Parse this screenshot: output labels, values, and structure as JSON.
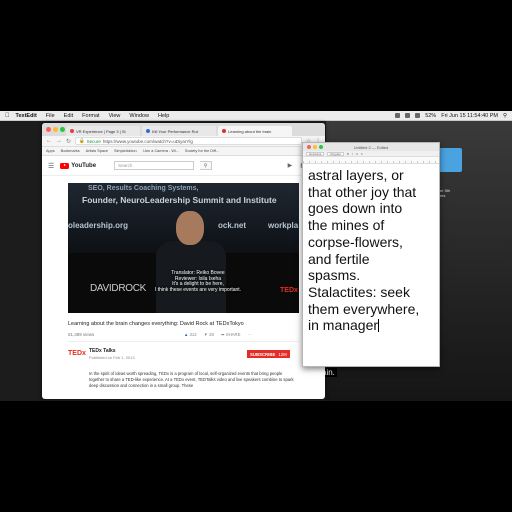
{
  "menubar": {
    "app": "TextEdit",
    "items": [
      "File",
      "Edit",
      "Format",
      "View",
      "Window",
      "Help"
    ],
    "clock": "Fri Jun 15  11:54:40 PM",
    "battery": "52%"
  },
  "desktop": {
    "label_line1": "er 5th",
    "label_line2": "ms",
    "caption": "ain."
  },
  "browser": {
    "tabs": [
      {
        "label": "VR Experience | Page 3 | St",
        "color": "#e0433a"
      },
      {
        "label": "Kill Your Performance Rut",
        "color": "#2b6de0"
      },
      {
        "label": "Learning about the brain",
        "color": "#e52d27"
      }
    ],
    "secure_label": "Secure",
    "url": "https://www.youtube.com/watch?v=uDiyarYlg",
    "bookmarks": [
      "Apps",
      "Bookmarks",
      "Artists Space",
      "SimpleAddon",
      "I Am a Camera - Wi...",
      "Society for the Diff..."
    ]
  },
  "youtube": {
    "logo": "YouTube",
    "search_placeholder": "Search",
    "video": {
      "wall_line1": "Founder, NeuroLeadership Summit and Institute",
      "wall_left": "oleadership.org",
      "wall_mid": "ock.net",
      "wall_right": "workpla",
      "speaker": "DAVIDROCK",
      "brand": "TEDx",
      "subtitles": [
        "Translator: Reiko Bovee",
        "Reviewer: Isila Iseha",
        "It's a delight to be here,",
        "I think these events are very important."
      ]
    },
    "title": "Learning about the brain changes everything: David Rock at TEDxTokyo",
    "views": "61,389 views",
    "likes": "312",
    "dislikes": "28",
    "share": "SHARE",
    "channel": {
      "logo": "TEDx",
      "name": "TEDx Talks",
      "published": "Published on Feb 1, 2013",
      "subscribe": "SUBSCRIBE",
      "subscribers": "12M"
    },
    "description": "In the spirit of ideas worth spreading, TEDx is a program of local, self-organized events that bring people together to share a TED-like experience. At a TEDx event, TEDTalks video and live speakers combine to spark deep discussion and connection in a small group. These"
  },
  "textedit": {
    "title": "Untitled 2 — Edited",
    "toolbar_style": "Helvetica",
    "toolbar_size": "Regular",
    "body": "astral layers, or\nthat other joy that\ngoes down into\nthe mines of\ncorpse-flowers,\nand fertile\nspasms.\nStalactites: seek\nthem everywhere,\nin manager"
  },
  "colors": {
    "youtube_red": "#e52d27",
    "ted_red": "#e62b1e",
    "secure_green": "#1a8a3a"
  }
}
